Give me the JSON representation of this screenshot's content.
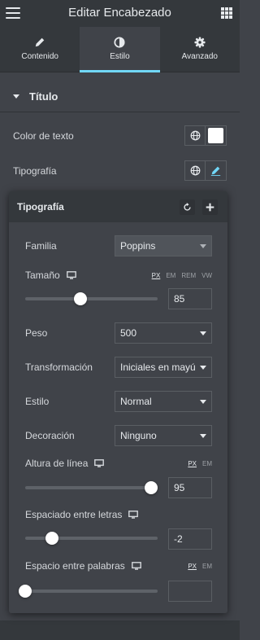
{
  "header": {
    "title": "Editar Encabezado",
    "menu_icon": "hamburger-icon",
    "apps_icon": "grid-icon"
  },
  "tabs": [
    {
      "label": "Contenido",
      "icon": "pencil-icon",
      "active": false
    },
    {
      "label": "Estilo",
      "icon": "contrast-icon",
      "active": true
    },
    {
      "label": "Avanzado",
      "icon": "gear-icon",
      "active": false
    }
  ],
  "section": {
    "title": "Título"
  },
  "controls": {
    "text_color_label": "Color de texto",
    "text_color_value": "#ffffff",
    "typography_label": "Tipografía"
  },
  "typography": {
    "title": "Tipografía",
    "family": {
      "label": "Familia",
      "value": "Poppins"
    },
    "size": {
      "label": "Tamaño",
      "value": "85",
      "units": [
        "PX",
        "EM",
        "REM",
        "VW"
      ],
      "active_unit": "PX",
      "slider_fraction": 0.42
    },
    "weight": {
      "label": "Peso",
      "value": "500"
    },
    "transform": {
      "label": "Transformación",
      "value": "Iniciales en mayú"
    },
    "style": {
      "label": "Estilo",
      "value": "Normal"
    },
    "decoration": {
      "label": "Decoración",
      "value": "Ninguno"
    },
    "line_height": {
      "label": "Altura de línea",
      "value": "95",
      "units": [
        "PX",
        "EM"
      ],
      "active_unit": "PX",
      "slider_fraction": 0.95
    },
    "letter_spacing": {
      "label": "Espaciado entre letras",
      "value": "-2",
      "slider_fraction": 0.2
    },
    "word_spacing": {
      "label": "Espacio entre palabras",
      "value": "",
      "units": [
        "PX",
        "EM"
      ],
      "active_unit": "PX",
      "slider_fraction": 0.0
    }
  },
  "colors": {
    "accent": "#71d7f7",
    "panel": "#404349",
    "header": "#34383c"
  }
}
